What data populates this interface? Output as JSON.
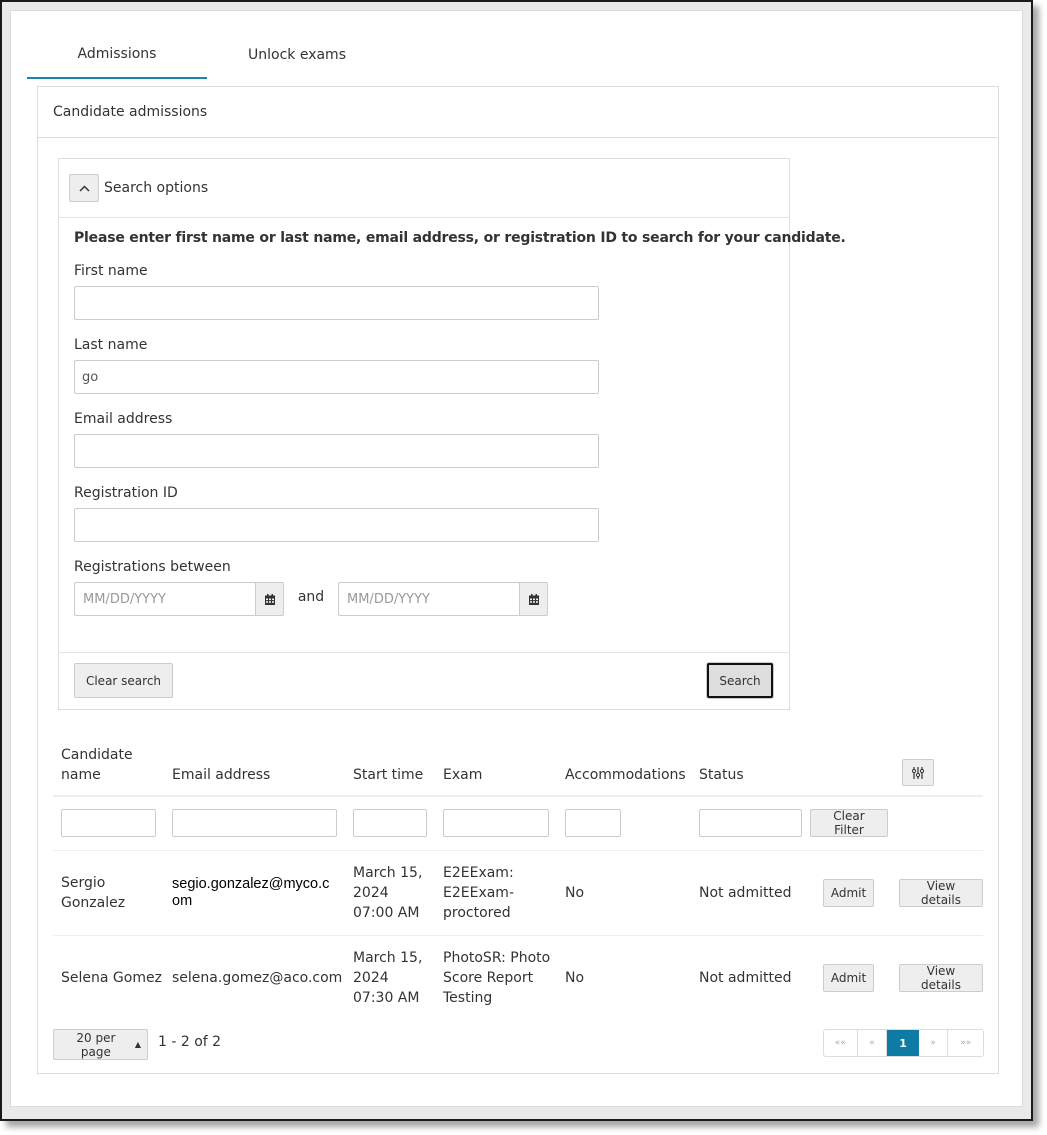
{
  "tabs": [
    {
      "label": "Admissions",
      "active": true
    },
    {
      "label": "Unlock exams",
      "active": false
    }
  ],
  "panel": {
    "title": "Candidate admissions"
  },
  "search": {
    "toggle_icon": "chevron-up-icon",
    "title": "Search options",
    "hint": "Please enter first name or last name, email address, or registration ID to search for your candidate.",
    "fields": {
      "first_name": {
        "label": "First name",
        "value": ""
      },
      "last_name": {
        "label": "Last name",
        "value": "go"
      },
      "email": {
        "label": "Email address",
        "value": ""
      },
      "registration_id": {
        "label": "Registration ID",
        "value": ""
      }
    },
    "date_range": {
      "label": "Registrations between",
      "from_placeholder": "MM/DD/YYYY",
      "to_placeholder": "MM/DD/YYYY",
      "joiner": "and",
      "icon": "calendar-icon"
    },
    "clear_label": "Clear search",
    "search_label": "Search"
  },
  "table": {
    "columns": [
      {
        "label": "Candidate name"
      },
      {
        "label": "Email address"
      },
      {
        "label": "Start time"
      },
      {
        "label": "Exam"
      },
      {
        "label": "Accommodations"
      },
      {
        "label": "Status"
      }
    ],
    "column_settings_icon": "sliders-icon",
    "clear_filter_label": "Clear Filter",
    "rows": [
      {
        "name": "Sergio Gonzalez",
        "email": "segio.gonzalez@myco.com",
        "start_time": "March 15, 2024 07:00 AM",
        "exam": "E2EExam: E2EExam-proctored",
        "accommodations": "No",
        "status": "Not admitted",
        "admit_label": "Admit",
        "view_label": "View details"
      },
      {
        "name": "Selena Gomez",
        "email": "selena.gomez@aco.com",
        "start_time": "March 15, 2024 07:30 AM",
        "exam": "PhotoSR: Photo Score Report Testing",
        "accommodations": "No",
        "status": "Not admitted",
        "admit_label": "Admit",
        "view_label": "View details"
      }
    ]
  },
  "pagination": {
    "per_page_label": "20 per page",
    "per_page_caret": "▲",
    "range_text": "1 - 2 of 2",
    "first": "««",
    "prev": "«",
    "current_page": "1",
    "next": "»",
    "last": "»»"
  },
  "colors": {
    "accent": "#0e7ba4",
    "tab_underline": "#1a86ad",
    "border": "#dddddd",
    "button_bg": "#eeeeee"
  }
}
